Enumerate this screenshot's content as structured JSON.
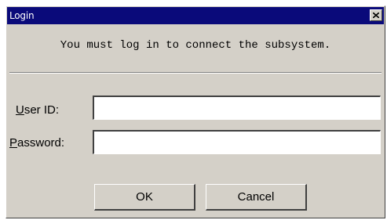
{
  "window": {
    "title": "Login",
    "close_icon": "close-x-icon"
  },
  "message": "You must log in to connect the subsystem.",
  "form": {
    "user_id": {
      "label_mnemonic": "U",
      "label_rest": "ser ID:",
      "value": ""
    },
    "password": {
      "label_mnemonic": "P",
      "label_rest": "assword:",
      "value": ""
    }
  },
  "buttons": {
    "ok_label": "OK",
    "cancel_label": "Cancel"
  },
  "colors": {
    "titlebar": "#0a0a7a",
    "dialog_face": "#d4d0c8",
    "title_text": "#ffffff"
  }
}
